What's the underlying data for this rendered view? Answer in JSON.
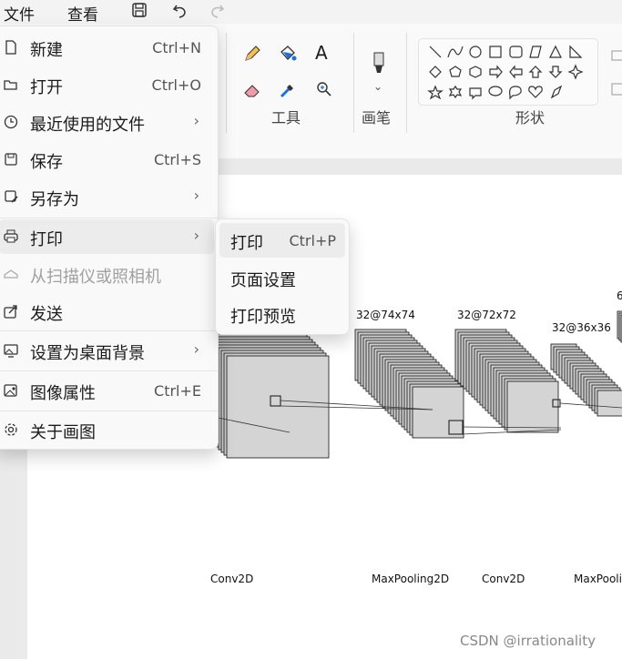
{
  "topbar": {
    "menu_file": "文件",
    "menu_view": "查看",
    "icons": [
      "save-icon",
      "undo-icon",
      "redo-icon"
    ]
  },
  "ribbon": {
    "tools_label": "工具",
    "brushes_label": "画笔",
    "shapes_label": "形状"
  },
  "file_menu": {
    "items": [
      {
        "label": "新建",
        "shortcut": "Ctrl+N",
        "icon": "new-file-icon"
      },
      {
        "label": "打开",
        "shortcut": "Ctrl+O",
        "icon": "open-folder-icon"
      },
      {
        "label": "最近使用的文件",
        "arrow": "›",
        "icon": "clock-icon"
      },
      {
        "label": "保存",
        "shortcut": "Ctrl+S",
        "icon": "save-icon"
      },
      {
        "label": "另存为",
        "arrow": "›",
        "icon": "save-as-icon"
      },
      {
        "label": "打印",
        "arrow": "›",
        "icon": "printer-icon"
      },
      {
        "label": "从扫描仪或照相机",
        "icon": "scanner-icon",
        "disabled": true
      },
      {
        "label": "发送",
        "icon": "share-icon"
      },
      {
        "label": "设置为桌面背景",
        "arrow": "›",
        "icon": "desktop-background-icon"
      },
      {
        "label": "图像属性",
        "shortcut": "Ctrl+E",
        "icon": "image-properties-icon"
      },
      {
        "label": "关于画图",
        "icon": "gear-icon"
      }
    ]
  },
  "print_submenu": {
    "items": [
      {
        "label": "打印",
        "shortcut": "Ctrl+P"
      },
      {
        "label": "页面设置"
      },
      {
        "label": "打印预览"
      }
    ]
  },
  "canvas": {
    "layer_labels": {
      "l1": "32@74x74",
      "l2": "32@72x72",
      "l3": "32@36x36",
      "l4_partial": "6"
    },
    "bottom_labels": {
      "b1": "Conv2D",
      "b2": "MaxPooling2D",
      "b3": "Conv2D",
      "b4": "MaxPooli"
    },
    "watermark": "CSDN @irrationality"
  }
}
